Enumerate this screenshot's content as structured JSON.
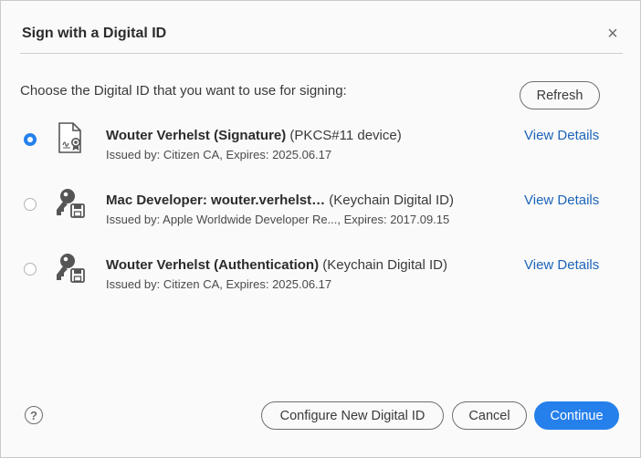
{
  "dialog": {
    "title": "Sign with a Digital ID",
    "close_glyph": "×",
    "prompt": "Choose the Digital ID that you want to use for signing:",
    "refresh_label": "Refresh"
  },
  "ids": [
    {
      "name": "Wouter Verhelst (Signature)",
      "type": " (PKCS#11 device)",
      "issued": "Issued by: Citizen CA, Expires: 2025.06.17",
      "details": "View Details",
      "selected": true,
      "icon": "certificate-document-icon"
    },
    {
      "name": "Mac Developer: wouter.verhelst…",
      "type": " (Keychain Digital ID)",
      "issued": "Issued by: Apple Worldwide Developer Re..., Expires: 2017.09.15",
      "details": "View Details",
      "selected": false,
      "icon": "key-disk-icon"
    },
    {
      "name": "Wouter Verhelst (Authentication)",
      "type": " (Keychain Digital ID)",
      "issued": "Issued by: Citizen CA, Expires: 2025.06.17",
      "details": "View Details",
      "selected": false,
      "icon": "key-disk-icon"
    }
  ],
  "footer": {
    "help_glyph": "?",
    "configure_label": "Configure New Digital ID",
    "cancel_label": "Cancel",
    "continue_label": "Continue"
  },
  "colors": {
    "accent": "#2680eb",
    "link": "#1d64b8",
    "background": "#fafafa"
  }
}
